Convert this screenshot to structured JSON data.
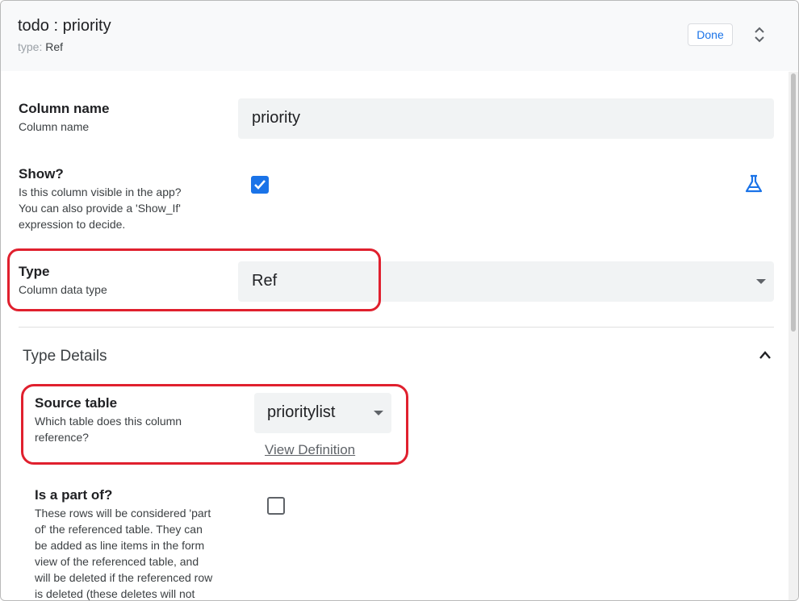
{
  "header": {
    "title": "todo : priority",
    "type_label": "type:",
    "type_value": "Ref",
    "done_label": "Done"
  },
  "fields": {
    "column_name": {
      "label": "Column name",
      "description": "Column name",
      "value": "priority"
    },
    "show": {
      "label": "Show?",
      "description_lines": [
        "Is this column visible in the app?",
        "You can also provide a 'Show_If'",
        "expression to decide."
      ],
      "checked": true
    },
    "type": {
      "label": "Type",
      "description": "Column data type",
      "value": "Ref"
    }
  },
  "type_details": {
    "section_title": "Type Details",
    "source_table": {
      "label": "Source table",
      "description_lines": [
        "Which table does this column",
        "reference?"
      ],
      "value": "prioritylist",
      "link_label": "View Definition"
    },
    "is_part_of": {
      "label": "Is a part of?",
      "description_lines": [
        "These rows will be considered 'part",
        "of' the referenced table. They can",
        "be added as line items in the form",
        "view of the referenced table, and",
        "will be deleted if the referenced row",
        "is deleted (these deletes will not"
      ],
      "checked": false
    }
  },
  "colors": {
    "accent": "#1a73e8",
    "highlight": "#e0202e"
  },
  "icons": {
    "expand": "expand-vertical-icon",
    "test_expression": "flask-icon",
    "collapse": "chevron-up-icon",
    "dropdown": "caret-down-icon",
    "check": "check-icon"
  }
}
